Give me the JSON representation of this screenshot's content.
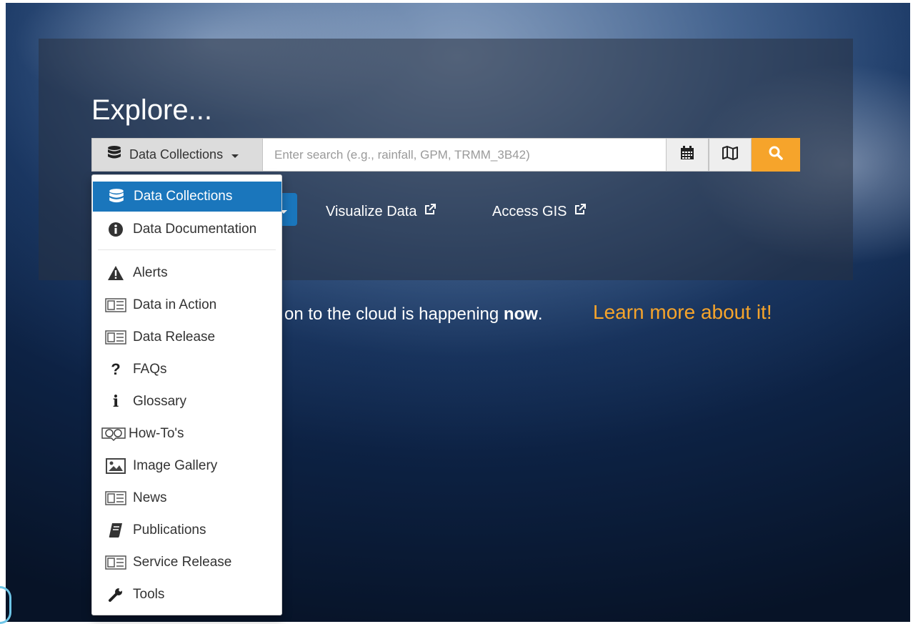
{
  "header": {
    "title": "Explore..."
  },
  "search": {
    "dropdown_label": "Data Collections",
    "placeholder": "Enter search (e.g., rainfall, GPM, TRMM_3B42)",
    "value": ""
  },
  "toolbar": {
    "calendar_icon": "calendar-icon",
    "map_icon": "map-icon",
    "search_icon": "search-icon"
  },
  "links": {
    "visualize": "Visualize Data",
    "gis": "Access GIS"
  },
  "banner": {
    "lead": "on to the cloud is happening",
    "emphasis": "now",
    "tail": ".",
    "cta": "Learn more about it!"
  },
  "menu": {
    "items": [
      {
        "label": "Data Collections",
        "icon": "database-icon",
        "active": true
      },
      {
        "label": "Data Documentation",
        "icon": "info-circle-icon",
        "active": false
      },
      {
        "label": "Alerts",
        "icon": "warning-icon",
        "active": false
      },
      {
        "label": "Data in Action",
        "icon": "newspaper-icon",
        "active": false
      },
      {
        "label": "Data Release",
        "icon": "newspaper-icon",
        "active": false
      },
      {
        "label": "FAQs",
        "icon": "question-icon",
        "active": false
      },
      {
        "label": "Glossary",
        "icon": "info-icon",
        "active": false
      },
      {
        "label": "How-To's",
        "icon": "book-open-icon",
        "active": false
      },
      {
        "label": "Image Gallery",
        "icon": "image-icon",
        "active": false
      },
      {
        "label": "News",
        "icon": "newspaper-icon",
        "active": false
      },
      {
        "label": "Publications",
        "icon": "book-icon",
        "active": false
      },
      {
        "label": "Service Release",
        "icon": "newspaper-icon",
        "active": false
      },
      {
        "label": "Tools",
        "icon": "wrench-icon",
        "active": false
      }
    ]
  },
  "colors": {
    "accent_orange": "#f6a42b",
    "accent_blue": "#1a76bc"
  }
}
